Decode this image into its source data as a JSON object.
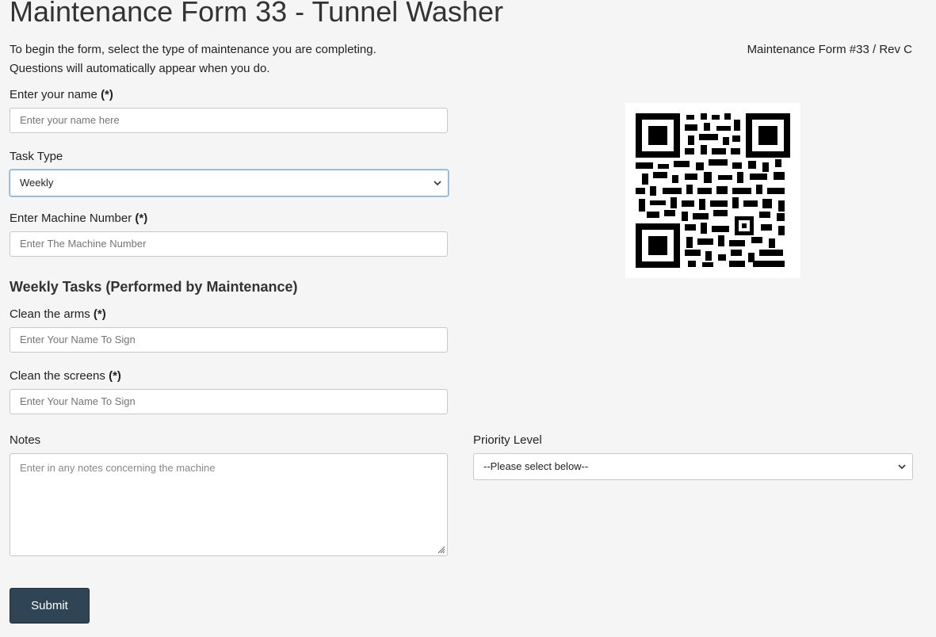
{
  "header": {
    "title": "Maintenance Form 33 - Tunnel Washer",
    "intro_line1": "To begin the form, select the type of maintenance you are completing.",
    "intro_line2": "Questions will automatically appear when you do.",
    "form_number": "Maintenance Form #33 / Rev C"
  },
  "form": {
    "required_marker": "(*)",
    "name": {
      "label": "Enter your name",
      "placeholder": "Enter your name here"
    },
    "task_type": {
      "label": "Task Type",
      "selected": "Weekly"
    },
    "machine": {
      "label": "Enter Machine Number",
      "placeholder": "Enter The Machine Number"
    },
    "section_heading": "Weekly Tasks (Performed by Maintenance)",
    "clean_arms": {
      "label": "Clean the arms",
      "placeholder": "Enter Your Name To Sign"
    },
    "clean_screens": {
      "label": "Clean the screens",
      "placeholder": "Enter Your Name To Sign"
    },
    "notes": {
      "label": "Notes",
      "placeholder": "Enter in any notes concerning the machine"
    },
    "priority": {
      "label": "Priority Level",
      "selected": "--Please select below--"
    },
    "submit_label": "Submit"
  },
  "qr_code": {
    "icon": "qr-code"
  },
  "colors": {
    "background": "#f5f5f5",
    "submit_button": "#2f4556",
    "focus_border": "#7fb0e0"
  }
}
